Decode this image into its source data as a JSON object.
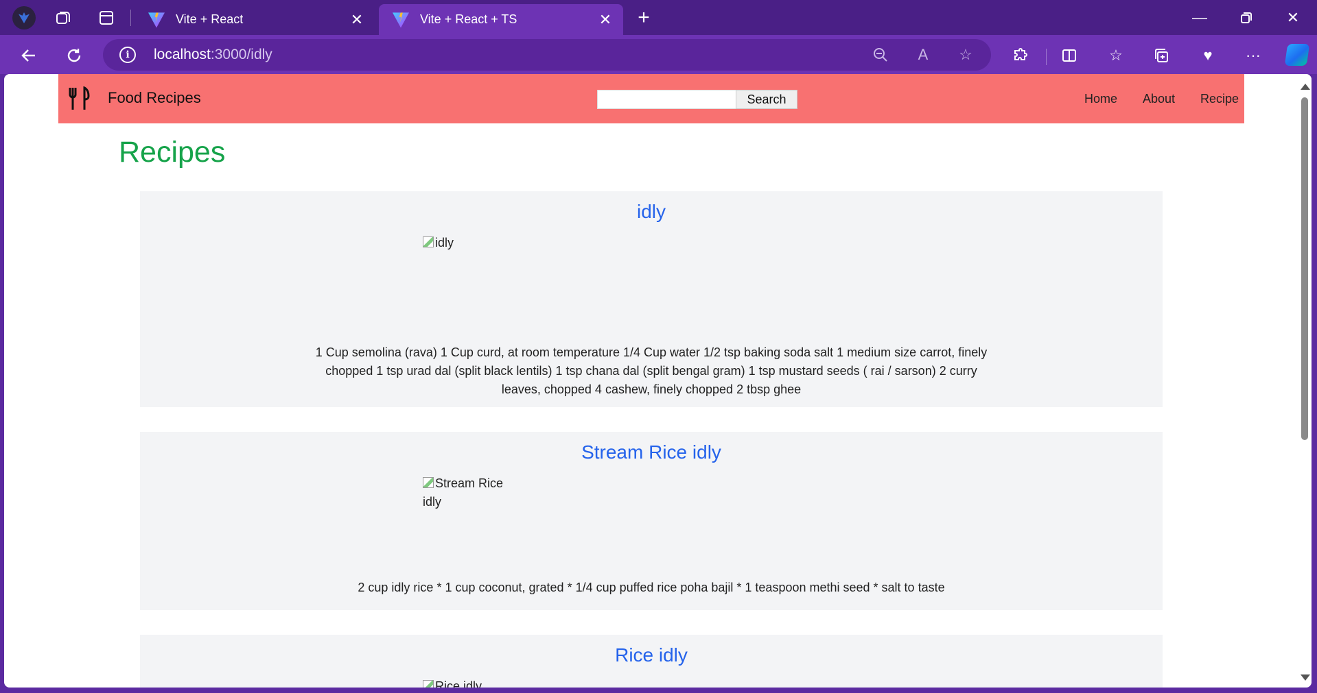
{
  "browser": {
    "tabs": [
      {
        "title": "Vite + React",
        "active": false
      },
      {
        "title": "Vite + React + TS",
        "active": true
      }
    ],
    "url_host": "localhost",
    "url_path": ":3000/idly",
    "accent_color": "#6d33b4"
  },
  "site": {
    "brand": "Food Recipes",
    "search_button": "Search",
    "search_value": "",
    "nav": [
      "Home",
      "About",
      "Recipe"
    ],
    "header_color": "#f87171"
  },
  "page": {
    "title": "Recipes",
    "title_color": "#16a34a",
    "recipes": [
      {
        "name": "idly",
        "image_alt": "idly",
        "ingredients": "1 Cup semolina (rava) 1 Cup curd, at room temperature 1/4 Cup water 1/2 tsp baking soda salt 1 medium size carrot, finely chopped 1 tsp urad dal (split black lentils) 1 tsp chana dal (split bengal gram) 1 tsp mustard seeds ( rai / sarson) 2 curry leaves, chopped 4 cashew, finely chopped 2 tbsp ghee"
      },
      {
        "name": "Stream Rice idly",
        "image_alt": "Stream Rice idly",
        "ingredients": "2 cup idly rice * 1 cup coconut, grated * 1/4 cup puffed rice poha bajil * 1 teaspoon methi seed * salt to taste"
      },
      {
        "name": "Rice idly",
        "image_alt": "Rice idly",
        "ingredients": ""
      }
    ]
  }
}
